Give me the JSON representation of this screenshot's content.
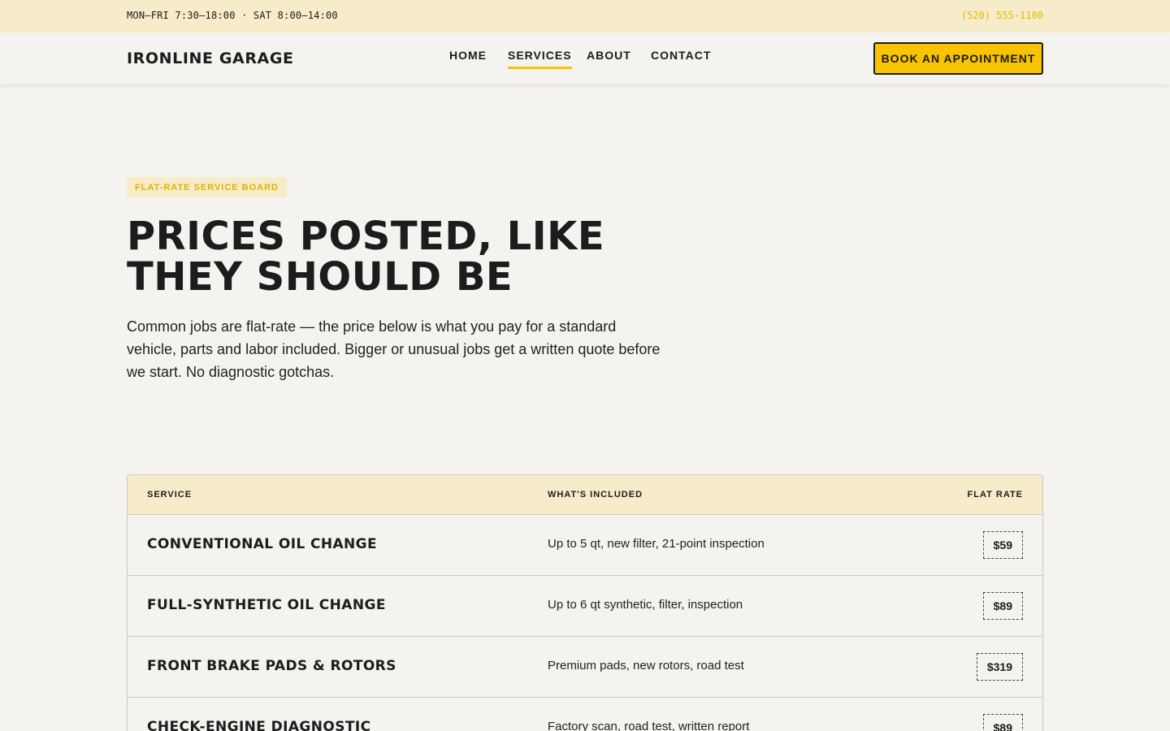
{
  "topbar": {
    "hours": "MON–FRI 7:30–18:00 · SAT 8:00–14:00",
    "phone": "(520) 555-1180"
  },
  "header": {
    "logo": "IRONLINE GARAGE",
    "nav": [
      {
        "label": "HOME",
        "active": false
      },
      {
        "label": "SERVICES",
        "active": true
      },
      {
        "label": "ABOUT",
        "active": false
      },
      {
        "label": "CONTACT",
        "active": false
      }
    ],
    "cta": "BOOK AN APPOINTMENT"
  },
  "hero": {
    "eyebrow": "FLAT-RATE SERVICE BOARD",
    "headline": "PRICES POSTED, LIKE THEY SHOULD BE",
    "intro": "Common jobs are flat-rate — the price below is what you pay for a standard vehicle, parts and labor included. Bigger or unusual jobs get a written quote before we start. No diagnostic gotchas."
  },
  "table": {
    "headers": [
      "SERVICE",
      "WHAT'S INCLUDED",
      "FLAT RATE"
    ],
    "rows": [
      {
        "service": "CONVENTIONAL OIL CHANGE",
        "included": "Up to 5 qt, new filter, 21-point inspection",
        "price": "$59"
      },
      {
        "service": "FULL-SYNTHETIC OIL CHANGE",
        "included": "Up to 6 qt synthetic, filter, inspection",
        "price": "$89"
      },
      {
        "service": "FRONT BRAKE PADS & ROTORS",
        "included": "Premium pads, new rotors, road test",
        "price": "$319"
      },
      {
        "service": "CHECK-ENGINE DIAGNOSTIC",
        "included": "Factory scan, road test, written report",
        "price": "$89"
      }
    ]
  },
  "colors": {
    "accent": "#f8c300",
    "cream": "#f6ecc9",
    "background": "#f4f3ef",
    "text": "#1c1c1c"
  }
}
